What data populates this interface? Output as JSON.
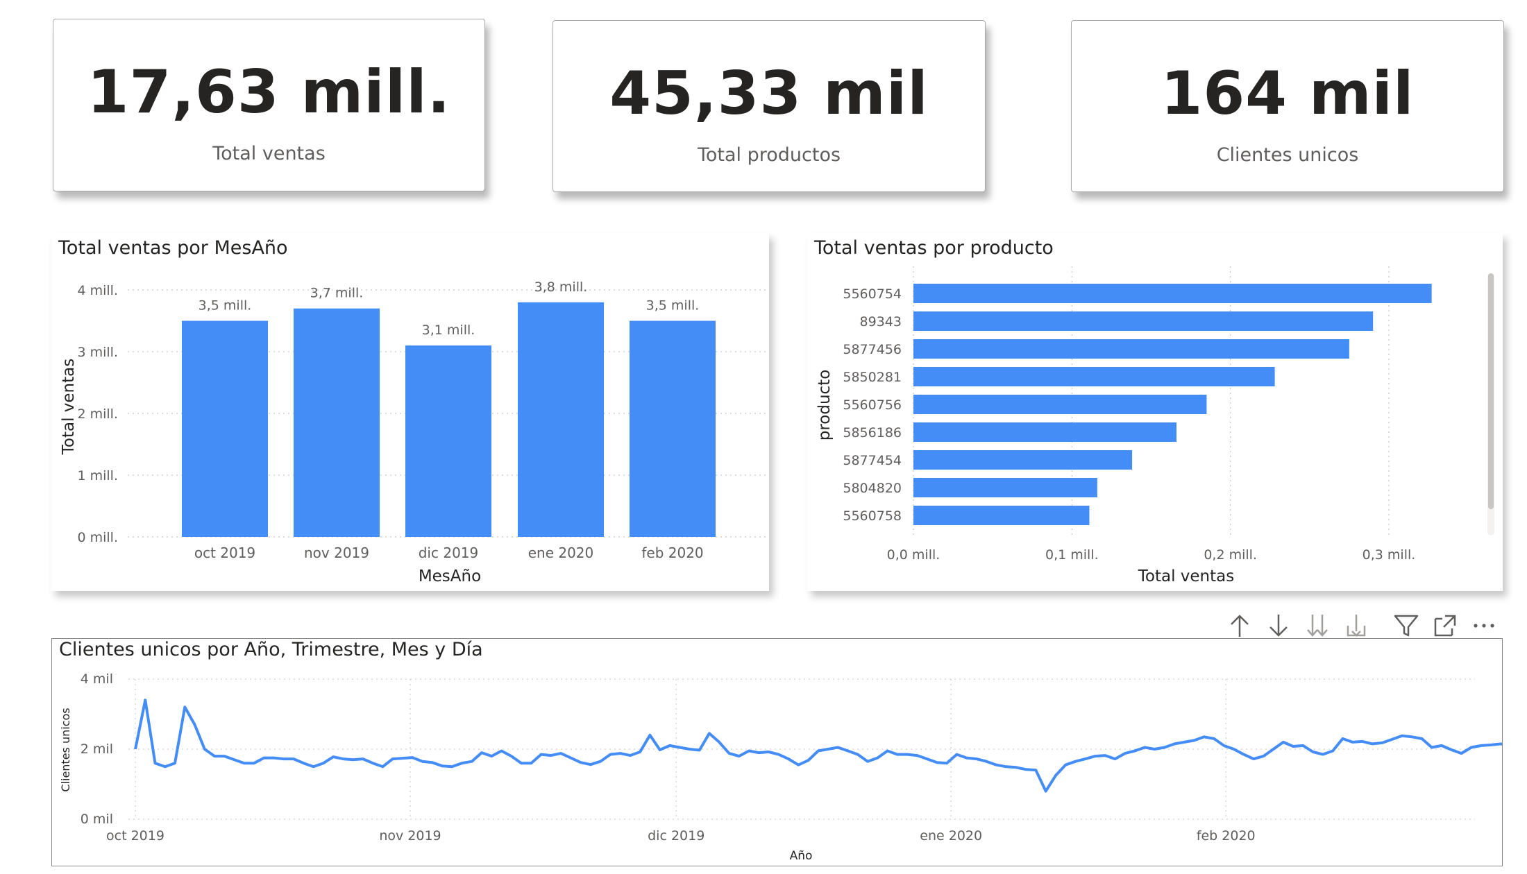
{
  "kpis": [
    {
      "value": "17,63 mill.",
      "label": "Total ventas"
    },
    {
      "value": "45,33 mil",
      "label": "Total productos"
    },
    {
      "value": "164 mil",
      "label": "Clientes unicos"
    }
  ],
  "bar_chart": {
    "title": "Total ventas por MesAño",
    "xlabel": "MesAño",
    "ylabel": "Total ventas",
    "yticks": [
      "0 mill.",
      "1 mill.",
      "2 mill.",
      "3 mill.",
      "4 mill."
    ],
    "bar_color": "#448cf6"
  },
  "hbar_chart": {
    "title": "Total ventas por producto",
    "xlabel": "Total ventas",
    "ylabel": "producto",
    "xticks": [
      "0,0 mill.",
      "0,1 mill.",
      "0,2 mill.",
      "0,3 mill."
    ],
    "bar_color": "#448cf6"
  },
  "line_chart": {
    "title": "Clientes unicos por Año, Trimestre, Mes y Día",
    "xlabel": "Año",
    "ylabel": "Clientes unicos",
    "yticks": [
      "0 mil",
      "2 mil",
      "4 mil"
    ],
    "xticks": [
      "oct 2019",
      "nov 2019",
      "dic 2019",
      "ene 2020",
      "feb 2020"
    ],
    "line_color": "#448cf6"
  },
  "toolbar": {
    "icons": [
      "arrow-up-icon",
      "arrow-down-icon",
      "double-arrow-down-icon",
      "expand-hierarchy-icon",
      "filter-icon",
      "focus-mode-icon",
      "more-options-icon"
    ]
  },
  "chart_data": [
    {
      "type": "bar",
      "title": "Total ventas por MesAño",
      "categories": [
        "oct 2019",
        "nov 2019",
        "dic 2019",
        "ene 2020",
        "feb 2020"
      ],
      "values": [
        3.5,
        3.7,
        3.1,
        3.8,
        3.5
      ],
      "data_labels": [
        "3,5 mill.",
        "3,7 mill.",
        "3,1 mill.",
        "3,8 mill.",
        "3,5 mill."
      ],
      "xlabel": "MesAño",
      "ylabel": "Total ventas",
      "ylim": [
        0,
        4
      ],
      "unit": "mill.",
      "grid": true
    },
    {
      "type": "bar",
      "orientation": "horizontal",
      "title": "Total ventas por producto",
      "categories": [
        "5560754",
        "89343",
        "5877456",
        "5850281",
        "5560756",
        "5856186",
        "5877454",
        "5804820",
        "5560758"
      ],
      "values": [
        0.327,
        0.29,
        0.275,
        0.228,
        0.185,
        0.166,
        0.138,
        0.116,
        0.111
      ],
      "xlabel": "Total ventas",
      "ylabel": "producto",
      "xlim": [
        0,
        0.35
      ],
      "unit": "mill.",
      "grid": true
    },
    {
      "type": "line",
      "title": "Clientes unicos por Año, Trimestre, Mes y Día",
      "xlabel": "Año",
      "ylabel": "Clientes unicos",
      "x_start": "2019-10-01",
      "x_end": "2020-03-22",
      "ylim": [
        0,
        4
      ],
      "unit": "mil",
      "grid": true,
      "values": [
        2.0,
        3.4,
        1.6,
        1.5,
        1.6,
        3.2,
        2.7,
        2.0,
        1.8,
        1.8,
        1.7,
        1.6,
        1.6,
        1.75,
        1.75,
        1.72,
        1.72,
        1.6,
        1.5,
        1.6,
        1.78,
        1.72,
        1.7,
        1.72,
        1.6,
        1.5,
        1.72,
        1.74,
        1.76,
        1.65,
        1.62,
        1.52,
        1.5,
        1.6,
        1.65,
        1.9,
        1.8,
        1.95,
        1.8,
        1.6,
        1.6,
        1.85,
        1.82,
        1.88,
        1.75,
        1.62,
        1.56,
        1.65,
        1.85,
        1.88,
        1.82,
        1.92,
        2.4,
        1.98,
        2.1,
        2.05,
        2.0,
        1.97,
        2.45,
        2.2,
        1.88,
        1.8,
        1.95,
        1.9,
        1.92,
        1.85,
        1.72,
        1.55,
        1.68,
        1.95,
        2.0,
        2.05,
        1.95,
        1.85,
        1.65,
        1.75,
        1.95,
        1.85,
        1.85,
        1.82,
        1.72,
        1.62,
        1.6,
        1.85,
        1.75,
        1.72,
        1.65,
        1.55,
        1.5,
        1.48,
        1.42,
        1.4,
        0.8,
        1.25,
        1.55,
        1.65,
        1.72,
        1.8,
        1.82,
        1.72,
        1.88,
        1.95,
        2.05,
        2.0,
        2.05,
        2.15,
        2.2,
        2.25,
        2.35,
        2.3,
        2.1,
        2.0,
        1.85,
        1.72,
        1.8,
        2.0,
        2.2,
        2.08,
        2.1,
        1.92,
        1.85,
        1.95,
        2.3,
        2.2,
        2.22,
        2.15,
        2.18,
        2.28,
        2.38,
        2.35,
        2.3,
        2.05,
        2.1,
        1.98,
        1.88,
        2.05,
        2.1,
        2.12,
        2.15,
        2.05,
        1.75,
        1.85,
        1.8,
        2.1,
        2.08,
        2.05,
        1.88,
        1.7,
        1.65,
        1.6,
        1.8,
        2.05,
        1.98,
        2.15,
        1.95,
        1.92
      ]
    }
  ]
}
